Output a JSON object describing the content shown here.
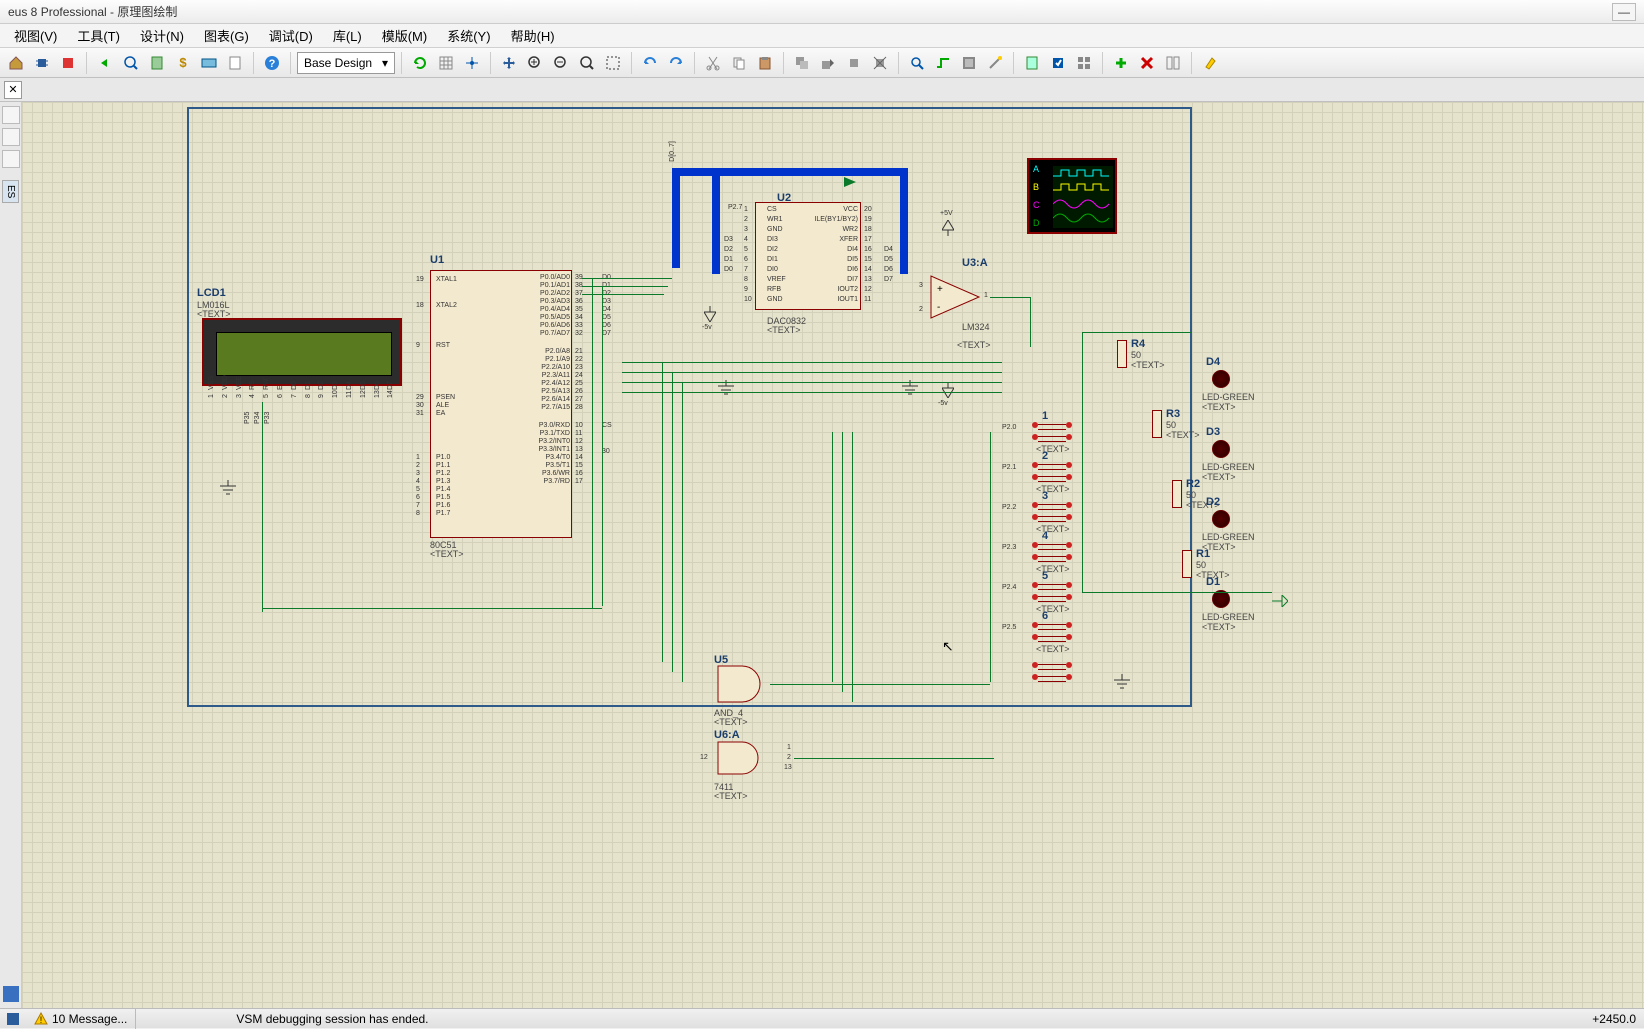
{
  "window": {
    "title": "eus 8 Professional - 原理图绘制"
  },
  "menu": {
    "items": [
      "视图(V)",
      "工具(T)",
      "设计(N)",
      "图表(G)",
      "调试(D)",
      "库(L)",
      "模版(M)",
      "系统(Y)",
      "帮助(H)"
    ]
  },
  "toolbar": {
    "design_dropdown": "Base Design"
  },
  "sidepanel": {
    "tab": "ES"
  },
  "components": {
    "lcd": {
      "ref": "LCD1",
      "part": "LM016L",
      "text": "<TEXT>",
      "pins": [
        "VSS",
        "VDD",
        "VEE",
        "RS",
        "RW",
        "E",
        "D0",
        "D1",
        "D2",
        "D3",
        "D4",
        "D5",
        "D6",
        "D7"
      ],
      "pinnums": [
        "1",
        "2",
        "3",
        "4",
        "5",
        "6",
        "7",
        "8",
        "9",
        "10",
        "11",
        "12",
        "13",
        "14"
      ],
      "ctrl": [
        "P35",
        "P34",
        "P33"
      ]
    },
    "u1": {
      "ref": "U1",
      "part": "80C51",
      "text": "<TEXT>",
      "left_pins": [
        "XTAL1",
        "XTAL2",
        "RST",
        "PSEN",
        "ALE",
        "EA",
        "P1.0",
        "P1.1",
        "P1.2",
        "P1.3",
        "P1.4",
        "P1.5",
        "P1.6",
        "P1.7"
      ],
      "left_nums": [
        "19",
        "18",
        "9",
        "29",
        "30",
        "31",
        "1",
        "2",
        "3",
        "4",
        "5",
        "6",
        "7",
        "8"
      ],
      "right_pins": [
        "P0.0/AD0",
        "P0.1/AD1",
        "P0.2/AD2",
        "P0.3/AD3",
        "P0.4/AD4",
        "P0.5/AD5",
        "P0.6/AD6",
        "P0.7/AD7",
        "P2.0/A8",
        "P2.1/A9",
        "P2.2/A10",
        "P2.3/A11",
        "P2.4/A12",
        "P2.5/A13",
        "P2.6/A14",
        "P2.7/A15",
        "P3.0/RXD",
        "P3.1/TXD",
        "P3.2/INT0",
        "P3.3/INT1",
        "P3.4/T0",
        "P3.5/T1",
        "P3.6/WR",
        "P3.7/RD"
      ],
      "right_nums": [
        "39",
        "38",
        "37",
        "36",
        "35",
        "34",
        "33",
        "32",
        "21",
        "22",
        "23",
        "24",
        "25",
        "26",
        "27",
        "28",
        "10",
        "11",
        "12",
        "13",
        "14",
        "15",
        "16",
        "17"
      ]
    },
    "u2": {
      "ref": "U2",
      "part": "DAC0832",
      "text": "<TEXT>",
      "left_pins": [
        "CS",
        "WR1",
        "GND",
        "DI3",
        "DI2",
        "DI1",
        "DI0",
        "VREF",
        "RFB",
        "GND"
      ],
      "left_nums": [
        "1",
        "2",
        "3",
        "4",
        "5",
        "6",
        "7",
        "8",
        "9",
        "10"
      ],
      "right_pins": [
        "VCC",
        "ILE(BY1/BY2)",
        "WR2",
        "XFER",
        "DI4",
        "DI5",
        "DI6",
        "DI7",
        "IOUT2",
        "IOUT1"
      ],
      "right_nums": [
        "20",
        "19",
        "18",
        "17",
        "16",
        "15",
        "14",
        "13",
        "12",
        "11"
      ],
      "bus": "D[0..7]"
    },
    "u3": {
      "ref": "U3:A",
      "part": "LM324",
      "text": "<TEXT>",
      "pins": [
        "3",
        "2",
        "1"
      ]
    },
    "u5": {
      "ref": "U5",
      "part": "AND_4",
      "text": "<TEXT>"
    },
    "u6": {
      "ref": "U6:A",
      "part": "7411",
      "text": "<TEXT>",
      "pins": [
        "12",
        "1",
        "2",
        "13"
      ]
    },
    "resistors": [
      {
        "ref": "R4",
        "val": "50",
        "text": "<TEXT>"
      },
      {
        "ref": "R3",
        "val": "50",
        "text": "<TEXT>"
      },
      {
        "ref": "R2",
        "val": "50",
        "text": "<TEXT>"
      },
      {
        "ref": "R1",
        "val": "50",
        "text": "<TEXT>"
      }
    ],
    "leds": [
      {
        "ref": "D4",
        "part": "LED-GREEN",
        "text": "<TEXT>"
      },
      {
        "ref": "D3",
        "part": "LED-GREEN",
        "text": "<TEXT>"
      },
      {
        "ref": "D2",
        "part": "LED-GREEN",
        "text": "<TEXT>"
      },
      {
        "ref": "D1",
        "part": "LED-GREEN",
        "text": "<TEXT>"
      }
    ],
    "switches": [
      {
        "label": "1",
        "net": "P2.0",
        "text": "<TEXT>"
      },
      {
        "label": "2",
        "net": "P2.1",
        "text": "<TEXT>"
      },
      {
        "label": "3",
        "net": "P2.2",
        "text": "<TEXT>"
      },
      {
        "label": "4",
        "net": "P2.3",
        "text": "<TEXT>"
      },
      {
        "label": "5",
        "net": "P2.4",
        "text": "<TEXT>"
      },
      {
        "label": "6",
        "net": "P2.5",
        "text": "<TEXT>"
      },
      {
        "label": "",
        "net": "",
        "text": ""
      }
    ],
    "power": {
      "plus5v": "+5V",
      "minus5v": "-5v",
      "minus5v2": "-5v"
    },
    "scope": {
      "ch": [
        "A",
        "B",
        "C",
        "D"
      ]
    },
    "nets": [
      "D0",
      "D1",
      "D2",
      "D3",
      "D4",
      "D5",
      "D6",
      "D7",
      "CS",
      "30",
      "P2.7"
    ]
  },
  "status": {
    "messages": "10 Message...",
    "session": "VSM debugging session has ended.",
    "coord": "+2450.0"
  }
}
